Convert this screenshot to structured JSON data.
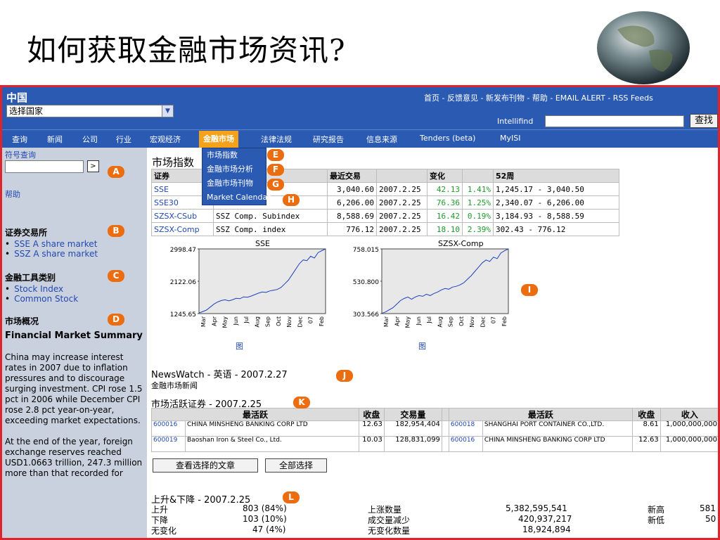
{
  "slide": {
    "title": "如何获取金融市场资讯?"
  },
  "header": {
    "site_name": "中国",
    "country_select": "选择国家",
    "top_links": "首页 - 反馈意见 - 新发布刊物 - 帮助 - EMAIL ALERT - RSS Feeds",
    "intellifind_label": "Intellifind",
    "search_button": "查找"
  },
  "nav": [
    "查询",
    "新闻",
    "公司",
    "行业",
    "宏观经济",
    "金融市场",
    "法律法规",
    "研究报告",
    "信息来源",
    "Tenders (beta)",
    "MyISI"
  ],
  "submenu": [
    "市场指数",
    "金融市场分析",
    "金融市场刊物",
    "Market Calendar"
  ],
  "markers": [
    "A",
    "B",
    "C",
    "D",
    "E",
    "F",
    "G",
    "H",
    "I",
    "J",
    "K",
    "L"
  ],
  "sidebar": {
    "symbol_lookup": "符号查询",
    "go": ">",
    "help": "帮助",
    "exchanges_head": "证券交易所",
    "exchanges": [
      "SSE A share market",
      "SSZ A share market"
    ],
    "instruments_head": "金融工具类别",
    "instruments": [
      "Stock Index",
      "Common Stock"
    ],
    "overview_head": "市场概况",
    "summary_title": "Financial Market Summary",
    "summary_p1": "China may increase interest rates in 2007 due to inflation pressures and to discourage surging investment. CPI rose 1.5 pct in 2006 while December CPI rose 2.8 pct year-on-year, exceeding market expectations.",
    "summary_p2": "At the end of the year, foreign exchange reserves reached USD1.0663 trillion, 247.3 million more than that recorded for"
  },
  "main": {
    "title": "市场指数",
    "index_headers": [
      "证券",
      "",
      "最近交易",
      "",
      "变化",
      "",
      "52周"
    ],
    "index_rows": [
      [
        "SSE",
        "",
        "3,040.60",
        "2007.2.25",
        "42.13",
        "1.41%",
        "1,245.17 - 3,040.50"
      ],
      [
        "SSE30",
        "",
        "6,206.00",
        "2007.2.25",
        "76.36",
        "1.25%",
        "2,340.07 - 6,206.00"
      ],
      [
        "SZSX-CSub",
        "SSZ Comp. Subindex",
        "8,588.69",
        "2007.2.25",
        "16.42",
        "0.19%",
        "3,184.93 - 8,588.59"
      ],
      [
        "SZSX-Comp",
        "SSZ Comp. index",
        "776.12",
        "2007.2.25",
        "18.10",
        "2.39%",
        "302.43 - 776.12"
      ]
    ],
    "chart_link": "图",
    "newswatch": "NewsWatch - 英语 - 2007.2.27",
    "newswatch_sub": "金融市场新闻",
    "active_head": "市场活跃证券 - 2007.2.25",
    "active_headers": [
      "最活跃",
      "收盘",
      "交易量",
      "",
      "最活跃",
      "收盘",
      "收入"
    ],
    "active_rows": [
      [
        "600016",
        "CHINA MINSHENG BANKING CORP LTD",
        "12.63",
        "182,954,404",
        "600018",
        "SHANGHAI PORT CONTAINER CO.,LTD.",
        "8.61",
        "1,000,000,000"
      ],
      [
        "600019",
        "Baoshan Iron & Steel Co., Ltd.",
        "10.03",
        "128,831,099",
        "600016",
        "CHINA MINSHENG BANKING CORP LTD",
        "12.63",
        "1,000,000,000"
      ]
    ],
    "btn_view": "查看选择的文章",
    "btn_all": "全部选择",
    "updown_head": "上升&下降 - 2007.2.25",
    "updown_rows": [
      [
        "上升",
        "803 (84%)",
        "上涨数量",
        "5,382,595,541",
        "新高",
        "581"
      ],
      [
        "下降",
        "103 (10%)",
        "成交量减少",
        "420,937,217",
        "新低",
        "50"
      ],
      [
        "无变化",
        "47 (4%)",
        "无变化数量",
        "18,924,894",
        "",
        ""
      ]
    ]
  },
  "chart_data": [
    {
      "type": "line",
      "title": "SSE",
      "x": [
        "Mar",
        "Apr",
        "May",
        "Jun",
        "Jul",
        "Aug",
        "Sep",
        "Oct",
        "Nov",
        "Dec",
        "07",
        "Feb"
      ],
      "yticks": [
        "2998.47",
        "2122.06",
        "1245.65"
      ],
      "ylim": [
        1245.65,
        2998.47
      ],
      "series": [
        {
          "values": [
            1260,
            1300,
            1340,
            1420,
            1500,
            1560,
            1600,
            1620,
            1590,
            1620,
            1660,
            1650,
            1700,
            1690,
            1720,
            1760,
            1800,
            1830,
            1820,
            1860,
            1880,
            1900,
            1950,
            2050,
            2150,
            2300,
            2450,
            2600,
            2700,
            2680,
            2800,
            2750,
            2900,
            2950,
            2998
          ]
        }
      ]
    },
    {
      "type": "line",
      "title": "SZSX-Comp",
      "x": [
        "Mar",
        "Apr",
        "May",
        "Jun",
        "Jul",
        "Aug",
        "Sep",
        "Oct",
        "Nov",
        "Dec",
        "07",
        "Feb"
      ],
      "yticks": [
        "758.015",
        "530.800",
        "303.566"
      ],
      "ylim": [
        303.566,
        758.015
      ],
      "series": [
        {
          "values": [
            305,
            315,
            330,
            345,
            370,
            395,
            410,
            420,
            405,
            420,
            430,
            425,
            440,
            430,
            445,
            455,
            470,
            480,
            475,
            490,
            495,
            505,
            520,
            545,
            570,
            600,
            630,
            660,
            680,
            670,
            700,
            690,
            730,
            745,
            758
          ]
        }
      ]
    }
  ]
}
